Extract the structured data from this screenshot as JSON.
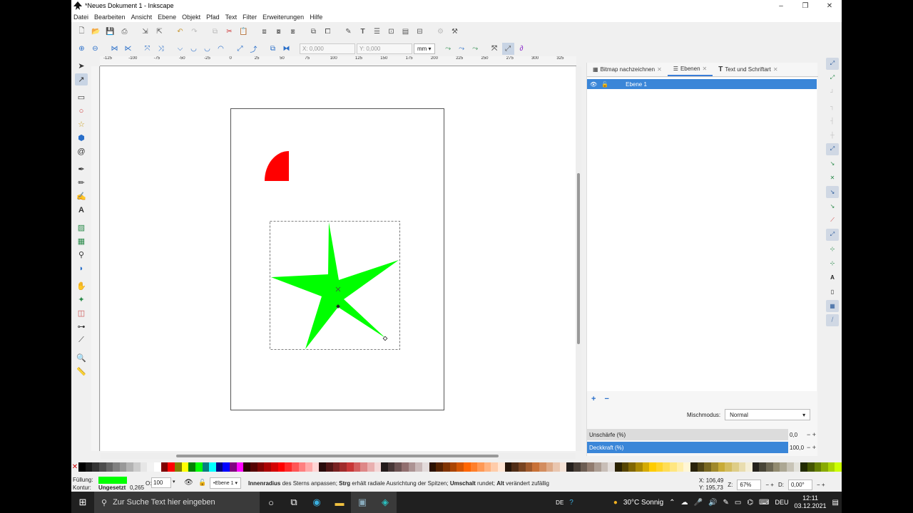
{
  "window": {
    "title": "*Neues Dokument 1 - Inkscape",
    "controls": [
      "–",
      "❐",
      "✕"
    ]
  },
  "menu": [
    "Datei",
    "Bearbeiten",
    "Ansicht",
    "Ebene",
    "Objekt",
    "Pfad",
    "Text",
    "Filter",
    "Erweiterungen",
    "Hilfe"
  ],
  "toolbar2": {
    "x_label": "X:",
    "x_value": "0,000",
    "y_label": "Y:",
    "y_value": "0,000",
    "unit": "mm"
  },
  "ruler_ticks": [
    "-125",
    "-100",
    "-75",
    "-50",
    "-25",
    "0",
    "25",
    "50",
    "75",
    "100",
    "125",
    "150",
    "175",
    "200",
    "225",
    "250",
    "275",
    "300",
    "325"
  ],
  "panel": {
    "tabs": [
      "Bitmap nachzeichnen",
      "Ebenen",
      "Text und Schriftart"
    ],
    "layer_name": "Ebene 1",
    "blend_label": "Mischmodus:",
    "blend_value": "Normal",
    "blur_label": "Unschärfe (%)",
    "blur_value": "0,0",
    "opacity_label": "Deckkraft (%)",
    "opacity_value": "100,0"
  },
  "colors": {
    "star": "#00ff00",
    "arc": "#ff0000",
    "accent": "#3a86d8"
  },
  "palette": [
    "#000000",
    "#1a1a1a",
    "#333333",
    "#4d4d4d",
    "#666666",
    "#808080",
    "#999999",
    "#b3b3b3",
    "#cccccc",
    "#e6e6e6",
    "#f2f2f2",
    "#ffffff",
    "#800000",
    "#ff0000",
    "#808000",
    "#ffff00",
    "#008000",
    "#00ff00",
    "#008080",
    "#00ffff",
    "#000080",
    "#0000ff",
    "#800080",
    "#ff00ff",
    "#2b0000",
    "#550000",
    "#800000",
    "#aa0000",
    "#d40000",
    "#ff0000",
    "#ff2a2a",
    "#ff5555",
    "#ff8080",
    "#ffaaaa",
    "#ffd5d5",
    "#280b0b",
    "#501616",
    "#782121",
    "#a02c2c",
    "#c83737",
    "#d35f5f",
    "#de8787",
    "#e9afaf",
    "#f4d7d7",
    "#241c1c",
    "#483737",
    "#6c5353",
    "#916f6f",
    "#ac9393",
    "#c8b7b7",
    "#e3dbdb",
    "#2b1100",
    "#552200",
    "#803300",
    "#aa4400",
    "#d45500",
    "#ff6600",
    "#ff7f2a",
    "#ff9955",
    "#ffb380",
    "#ffccaa",
    "#ffe6d5",
    "#28170b",
    "#502d16",
    "#784421",
    "#a05a2c",
    "#c87137",
    "#d38d5f",
    "#deaa87",
    "#e9c6af",
    "#f4e3d7",
    "#241f1c",
    "#483e37",
    "#6c5d53",
    "#917c6f",
    "#ac9d93",
    "#c8beb7",
    "#e3dedb",
    "#2b2200",
    "#554400",
    "#806600",
    "#aa8800",
    "#d4aa00",
    "#ffcc00",
    "#ffd42a",
    "#ffdd55",
    "#ffe680",
    "#ffeeaa",
    "#fff6d5",
    "#28220b",
    "#504416",
    "#786721",
    "#a0892c",
    "#c8ab37",
    "#d3bc5f",
    "#decd87",
    "#e9ddaf",
    "#f4eed7",
    "#24221c",
    "#484537",
    "#6c6753",
    "#918a6f",
    "#aca793",
    "#c8c4b7",
    "#e3e2db",
    "#222b00",
    "#445500",
    "#668000",
    "#88aa00",
    "#aad400",
    "#ccff00"
  ],
  "status": {
    "fill_label": "Füllung:",
    "stroke_label": "Kontur:",
    "stroke_value": "Ungesetzt",
    "stroke_width": "0,265",
    "opacity_label": "O:",
    "opacity_value": "100",
    "layer": "•Ebene 1",
    "msg_bold1": "Innenradius",
    "msg1": " des Sterns anpassen; ",
    "msg_bold2": "Strg",
    "msg2": " erhält radiale Ausrichtung der Spitzen; ",
    "msg_bold3": "Umschalt",
    "msg3": " rundet; ",
    "msg_bold4": "Alt",
    "msg4": " verändert zufällig",
    "x_label": "X:",
    "x_value": "106,49",
    "y_label": "Y:",
    "y_value": "195,73",
    "zoom_label": "Z:",
    "zoom_value": "67%",
    "rot_label": "D:",
    "rot_value": "0,00°"
  },
  "taskbar": {
    "search_placeholder": "Zur Suche Text hier eingeben",
    "lang_small": "DE",
    "weather": "30°C  Sonnig",
    "lang": "DEU",
    "time": "12:11",
    "date": "03.12.2021"
  }
}
